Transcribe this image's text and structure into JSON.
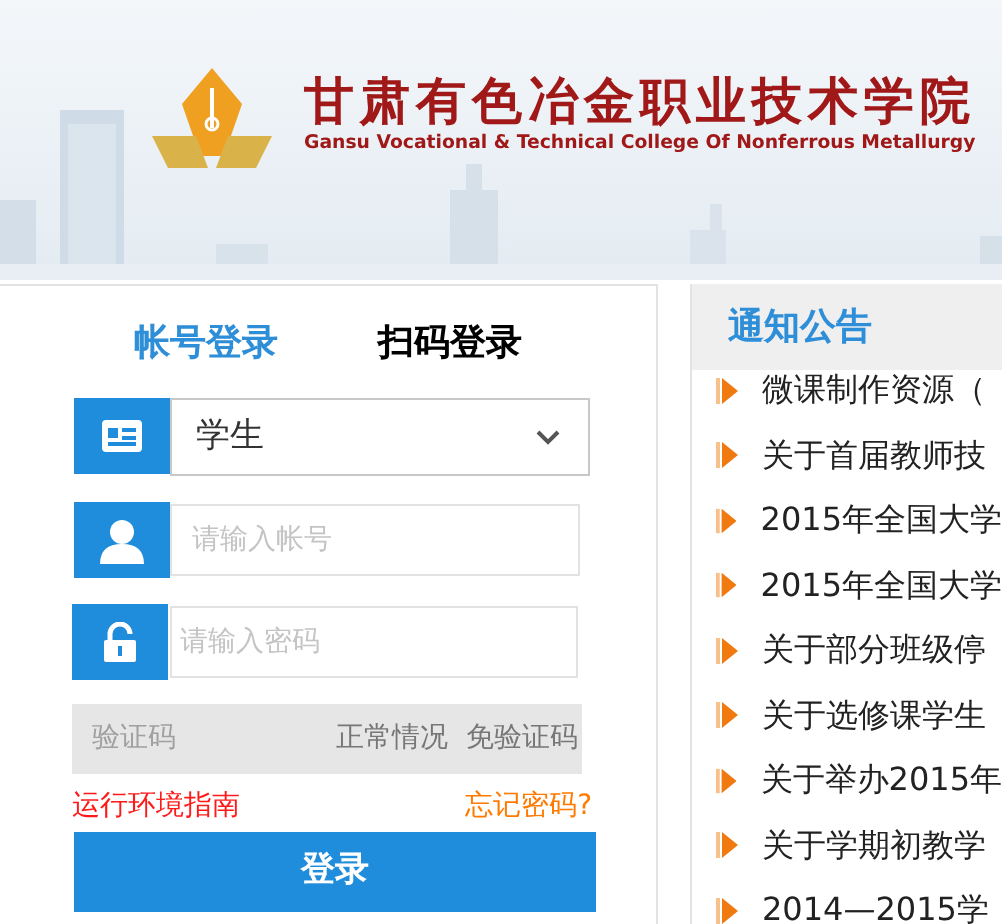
{
  "header": {
    "title": "甘肃有色冶金职业技术学院",
    "subtitle": "Gansu Vocational & Technical College Of Nonferrous Metallurgy"
  },
  "login": {
    "tabs": [
      {
        "label": "帐号登录",
        "selected": true
      },
      {
        "label": "扫码登录",
        "selected": false
      }
    ],
    "role": {
      "value": "学生"
    },
    "account": {
      "placeholder": "请输入帐号"
    },
    "password": {
      "placeholder": "请输入密码"
    },
    "captcha": {
      "placeholder": "验证码",
      "note": "正常情况  免验证码"
    },
    "guide_link": "运行环境指南",
    "forgot_link": "忘记密码?",
    "submit": "登录"
  },
  "notices": {
    "title": "通知公告",
    "items": [
      "微课制作资源（",
      "关于首届教师技",
      "2015年全国大学",
      "2015年全国大学",
      "关于部分班级停",
      "关于选修课学生",
      "关于举办2015年",
      "关于学期初教学",
      "2014—2015学"
    ]
  }
}
